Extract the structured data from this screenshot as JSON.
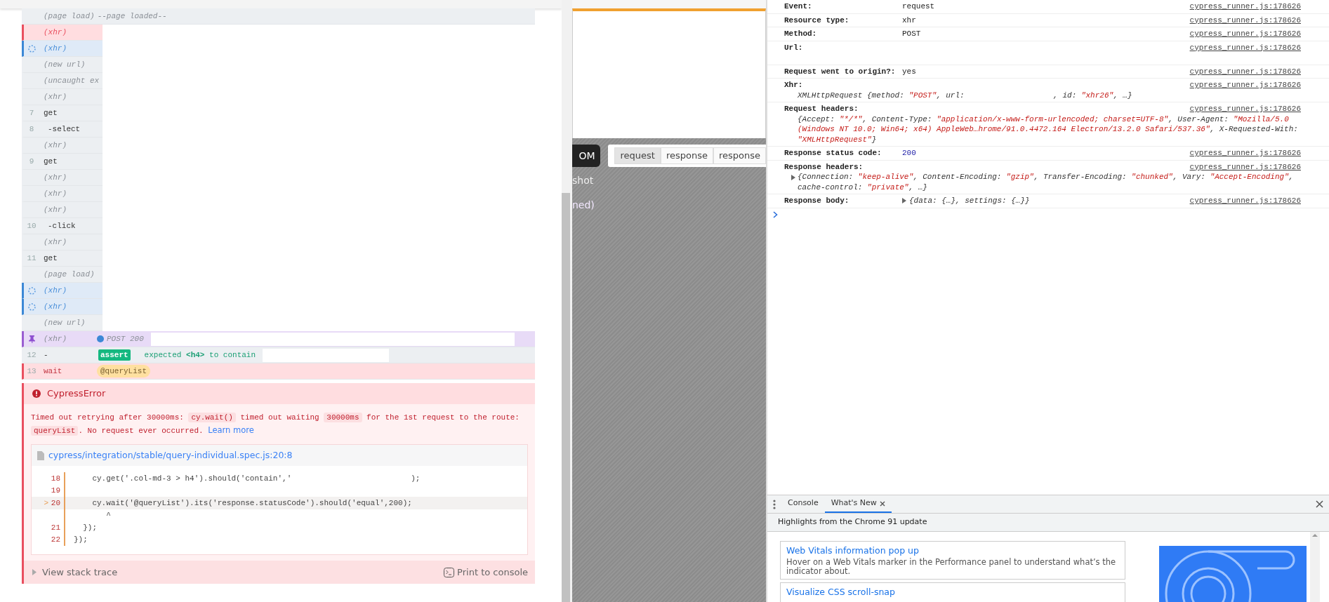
{
  "command_log": {
    "rows": [
      {
        "label": "(page load)",
        "kind": "event",
        "failed": false,
        "pending": false,
        "pinned": false,
        "message": "--page loaded--"
      },
      {
        "label": "(xhr)",
        "kind": "event",
        "failed": true,
        "pending": false,
        "pinned": false
      },
      {
        "label": "(xhr)",
        "kind": "event",
        "failed": false,
        "pending": true,
        "pinned": false
      },
      {
        "label": "(new url)",
        "kind": "event",
        "failed": false,
        "pending": false,
        "pinned": false
      },
      {
        "label": "(uncaught ex",
        "kind": "event",
        "failed": false,
        "pending": false,
        "pinned": false
      },
      {
        "label": "(xhr)",
        "kind": "event",
        "failed": false,
        "pending": false,
        "pinned": false
      },
      {
        "number": "7",
        "label": "get",
        "kind": "command",
        "failed": false,
        "pending": false,
        "pinned": false
      },
      {
        "number": "8",
        "label": "-select",
        "kind": "child",
        "failed": false,
        "pending": false,
        "pinned": false
      },
      {
        "label": "(xhr)",
        "kind": "event",
        "failed": false,
        "pending": false,
        "pinned": false
      },
      {
        "number": "9",
        "label": "get",
        "kind": "command",
        "failed": false,
        "pending": false,
        "pinned": false
      },
      {
        "label": "(xhr)",
        "kind": "event",
        "failed": false,
        "pending": false,
        "pinned": false
      },
      {
        "label": "(xhr)",
        "kind": "event",
        "failed": false,
        "pending": false,
        "pinned": false
      },
      {
        "label": "(xhr)",
        "kind": "event",
        "failed": false,
        "pending": false,
        "pinned": false
      },
      {
        "number": "10",
        "label": "-click",
        "kind": "child",
        "failed": false,
        "pending": false,
        "pinned": false
      },
      {
        "label": "(xhr)",
        "kind": "event",
        "failed": false,
        "pending": false,
        "pinned": false
      },
      {
        "number": "11",
        "label": "get",
        "kind": "command",
        "failed": false,
        "pending": false,
        "pinned": false
      },
      {
        "label": "(page load)",
        "kind": "event",
        "failed": false,
        "pending": false,
        "pinned": false
      },
      {
        "label": "(xhr)",
        "kind": "event",
        "failed": false,
        "pending": true,
        "pinned": false
      },
      {
        "label": "(xhr)",
        "kind": "event",
        "failed": false,
        "pending": true,
        "pinned": false
      },
      {
        "label": "(new url)",
        "kind": "event",
        "failed": false,
        "pending": false,
        "pinned": false
      },
      {
        "label": "(xhr)",
        "kind": "event",
        "failed": false,
        "pending": false,
        "pinned": true,
        "dot": true,
        "message": "POST 200"
      },
      {
        "number": "12",
        "label": "-",
        "kind": "assertion",
        "failed": false,
        "pending": false,
        "pinned": false,
        "badge": "assert",
        "message": "expected **<h4>** to contain"
      },
      {
        "number": "13",
        "label": "wait",
        "kind": "command",
        "failed": true,
        "pending": false,
        "pinned": false,
        "alias": "@queryList"
      }
    ]
  },
  "error": {
    "title": "CypressError",
    "message": [
      {
        "kind": "text",
        "text": "Timed out retrying after 30000ms: "
      },
      {
        "kind": "code",
        "text": "cy.wait()"
      },
      {
        "kind": "text",
        "text": " timed out waiting "
      },
      {
        "kind": "code",
        "text": "30000ms"
      },
      {
        "kind": "text",
        "text": " for the 1st request to the route: "
      },
      {
        "kind": "code",
        "text": "queryList"
      },
      {
        "kind": "text",
        "text": ". No request ever occurred. "
      },
      {
        "kind": "link",
        "text": "Learn more"
      }
    ],
    "file_link": "cypress/integration/stable/query-individual.spec.js:20:8",
    "code_lines": [
      {
        "number": "18",
        "code": "    cy.get('.col-md-3 > h4').should('contain','",
        "tail": ");",
        "current": false
      },
      {
        "number": "19",
        "current": false
      },
      {
        "number": "20",
        "marker": ">",
        "code": "    cy.wait('@queryList').its('response.statusCode').should('equal',200);",
        "current": true
      },
      {
        "code": "       ^",
        "current": false
      },
      {
        "number": "21",
        "code": "  });",
        "current": false
      },
      {
        "number": "22",
        "code": "});",
        "current": false
      }
    ],
    "stack_toggle": "View stack trace",
    "print_button": "Print to console"
  },
  "preview": {
    "dom_button": "OM",
    "tabs": [
      {
        "label": "request",
        "selected": true
      },
      {
        "label": "response",
        "selected": false
      },
      {
        "label": "response",
        "selected": false
      }
    ],
    "snapshot_text": "shot",
    "pinned_text": "ned)"
  },
  "console": {
    "rows": [
      {
        "label": "Event:",
        "kind": "inline",
        "value": [
          {
            "kind": "text",
            "text": "request"
          }
        ],
        "source": "cypress_runner.js:178626"
      },
      {
        "label": "Resource type:",
        "kind": "inline",
        "value": [
          {
            "kind": "text",
            "text": "xhr"
          }
        ],
        "source": "cypress_runner.js:178626"
      },
      {
        "label": "Method:",
        "kind": "inline",
        "value": [
          {
            "kind": "text",
            "text": "POST"
          }
        ],
        "source": "cypress_runner.js:178626"
      },
      {
        "label": "Url:",
        "kind": "redacted",
        "source": "cypress_runner.js:178626"
      },
      {
        "label": "Request went to origin?:",
        "kind": "inline",
        "value": [
          {
            "kind": "text",
            "text": "yes"
          }
        ],
        "source": "cypress_runner.js:178626"
      },
      {
        "label": "Xhr:",
        "kind": "block",
        "value": [
          {
            "kind": "key",
            "text": "XMLHttpRequest {method: "
          },
          {
            "kind": "string",
            "text": "\"POST\""
          },
          {
            "kind": "key",
            "text": ", url: "
          },
          {
            "kind": "gap"
          },
          {
            "kind": "key",
            "text": ", id: "
          },
          {
            "kind": "string",
            "text": "\"xhr26\""
          },
          {
            "kind": "key",
            "text": ", …}"
          }
        ],
        "source": "cypress_runner.js:178626"
      },
      {
        "label": "Request headers:",
        "kind": "block",
        "value": [
          {
            "kind": "key",
            "text": "{Accept: "
          },
          {
            "kind": "string",
            "text": "\"*/*\""
          },
          {
            "kind": "key",
            "text": ", Content-Type: "
          },
          {
            "kind": "string",
            "text": "\"application/x-www-form-urlencoded; charset=UTF-8\""
          },
          {
            "kind": "key",
            "text": ", User-Agent: "
          },
          {
            "kind": "string",
            "text": "\"Mozilla/5.0 (Windows NT 10.0; Win64; x64) AppleWeb…hrome/91.0.4472.164 Electron/13.2.0 Safari/537.36\""
          },
          {
            "kind": "key",
            "text": ", X-Requested-With: "
          },
          {
            "kind": "string",
            "text": "\"XMLHttpRequest\""
          },
          {
            "kind": "key",
            "text": "}"
          }
        ],
        "source": "cypress_runner.js:178626"
      },
      {
        "label": "Response status code:",
        "kind": "inline",
        "value": [
          {
            "kind": "number",
            "text": "200"
          }
        ],
        "source": "cypress_runner.js:178626"
      },
      {
        "label": "Response headers:",
        "kind": "block",
        "expandable": true,
        "value": [
          {
            "kind": "key",
            "text": "{Connection: "
          },
          {
            "kind": "string",
            "text": "\"keep-alive\""
          },
          {
            "kind": "key",
            "text": ", Content-Encoding: "
          },
          {
            "kind": "string",
            "text": "\"gzip\""
          },
          {
            "kind": "key",
            "text": ", Transfer-Encoding: "
          },
          {
            "kind": "string",
            "text": "\"chunked\""
          },
          {
            "kind": "key",
            "text": ", Vary: "
          },
          {
            "kind": "string",
            "text": "\"Accept-Encoding\""
          },
          {
            "kind": "key",
            "text": ", cache-control: "
          },
          {
            "kind": "string",
            "text": "\"private\""
          },
          {
            "kind": "key",
            "text": ", …}"
          }
        ],
        "source": "cypress_runner.js:178626"
      },
      {
        "label": "Response body:",
        "kind": "inline",
        "expandable": true,
        "value": [
          {
            "kind": "key",
            "text": "{data: {…}, settings: {…}}"
          }
        ],
        "source": "cypress_runner.js:178626"
      }
    ]
  },
  "drawer": {
    "tabs": [
      {
        "label": "Console",
        "selected": false,
        "closable": false
      },
      {
        "label": "What's New",
        "selected": true,
        "closable": true
      }
    ],
    "header": "Highlights from the Chrome 91 update",
    "cards": [
      {
        "title": "Web Vitals information pop up",
        "description": "Hover on a Web Vitals marker in the Performance panel to understand what’s the indicator about."
      },
      {
        "title": "Visualize CSS scroll-snap"
      }
    ]
  }
}
